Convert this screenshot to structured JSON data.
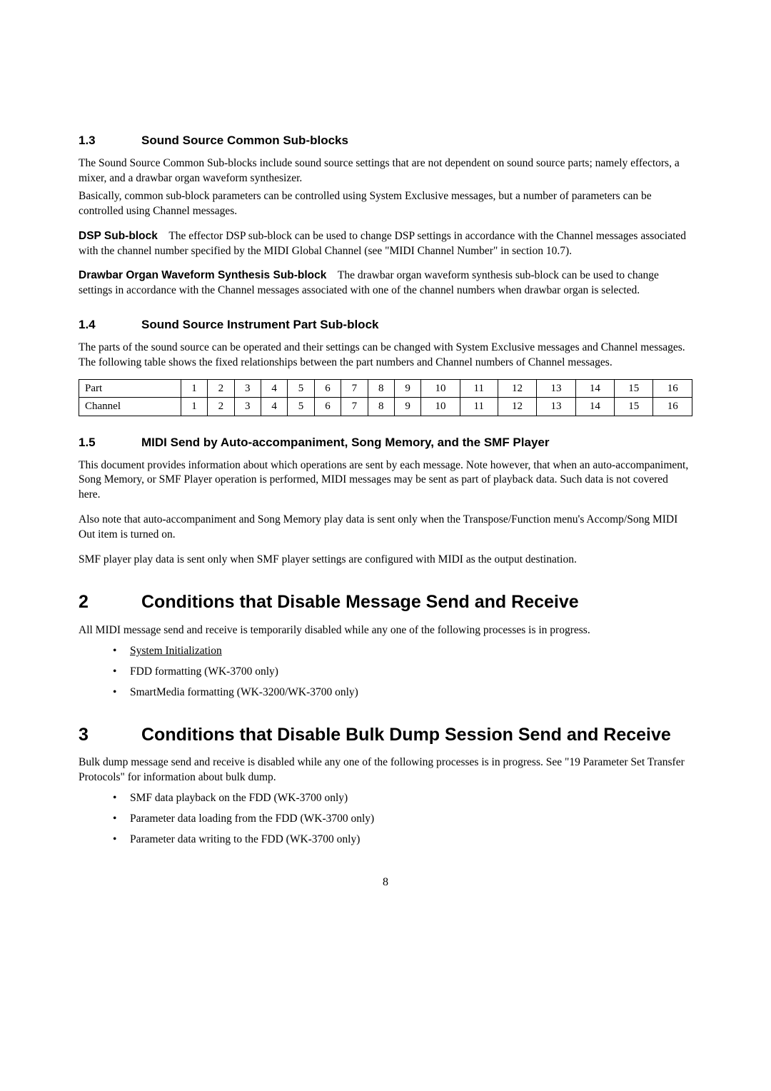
{
  "s13": {
    "num": "1.3",
    "title": "Sound Source Common Sub-blocks",
    "p1": "The Sound Source Common Sub-blocks include sound source settings that are not dependent on sound source parts; namely effectors, a mixer, and a drawbar organ waveform synthesizer.",
    "p2": "Basically, common sub-block parameters can be controlled using System Exclusive messages, but a number of parameters can be controlled using Channel messages.",
    "dsp_head": "DSP Sub-block",
    "dsp_body": "The effector DSP sub-block can be used to change DSP settings in accordance with the Channel messages associated with the channel number specified by the MIDI Global Channel (see \"MIDI Channel Number\" in section 10.7).",
    "draw_head": "Drawbar Organ Waveform Synthesis Sub-block",
    "draw_body": "The drawbar organ waveform synthesis sub-block can be used to change settings in accordance with the Channel messages associated with one of the channel numbers when drawbar organ is selected."
  },
  "s14": {
    "num": "1.4",
    "title": "Sound Source Instrument Part Sub-block",
    "p1": "The parts of the sound source can be operated and their settings can be changed with System Exclusive messages and Channel messages. The following table shows the fixed relationships between the part numbers and Channel numbers of Channel messages.",
    "row1_label": "Part",
    "row2_label": "Channel",
    "cells": [
      "1",
      "2",
      "3",
      "4",
      "5",
      "6",
      "7",
      "8",
      "9",
      "10",
      "11",
      "12",
      "13",
      "14",
      "15",
      "16"
    ]
  },
  "s15": {
    "num": "1.5",
    "title": "MIDI Send by Auto-accompaniment, Song Memory, and the SMF Player",
    "p1": "This document provides information about which operations are sent by each message. Note however, that when an auto-accompaniment, Song Memory, or SMF Player operation is performed, MIDI messages may be sent as part of playback data. Such data is not covered here.",
    "p2": "Also note that auto-accompaniment and Song Memory play data is sent only when the Transpose/Function menu's Accomp/Song MIDI Out item is turned on.",
    "p3": "SMF player play data is sent only when SMF player settings are configured with MIDI as the output destination."
  },
  "s2": {
    "num": "2",
    "title": "Conditions that Disable Message Send and Receive",
    "p1": "All MIDI message send and receive is temporarily disabled while any one of the following processes is in progress.",
    "items": [
      "System Initialization",
      "FDD formatting (WK-3700 only)",
      "SmartMedia formatting (WK-3200/WK-3700 only)"
    ]
  },
  "s3": {
    "num": "3",
    "title": "Conditions that Disable Bulk Dump Session Send and Receive",
    "p1": "Bulk dump message send and receive is disabled while any one of the following processes is in progress. See \"19 Parameter Set Transfer Protocols\" for information about bulk dump.",
    "items": [
      "SMF data playback on the FDD (WK-3700 only)",
      "Parameter data loading from the FDD (WK-3700 only)",
      "Parameter data writing to the FDD  (WK-3700 only)"
    ]
  },
  "page_number": "8"
}
